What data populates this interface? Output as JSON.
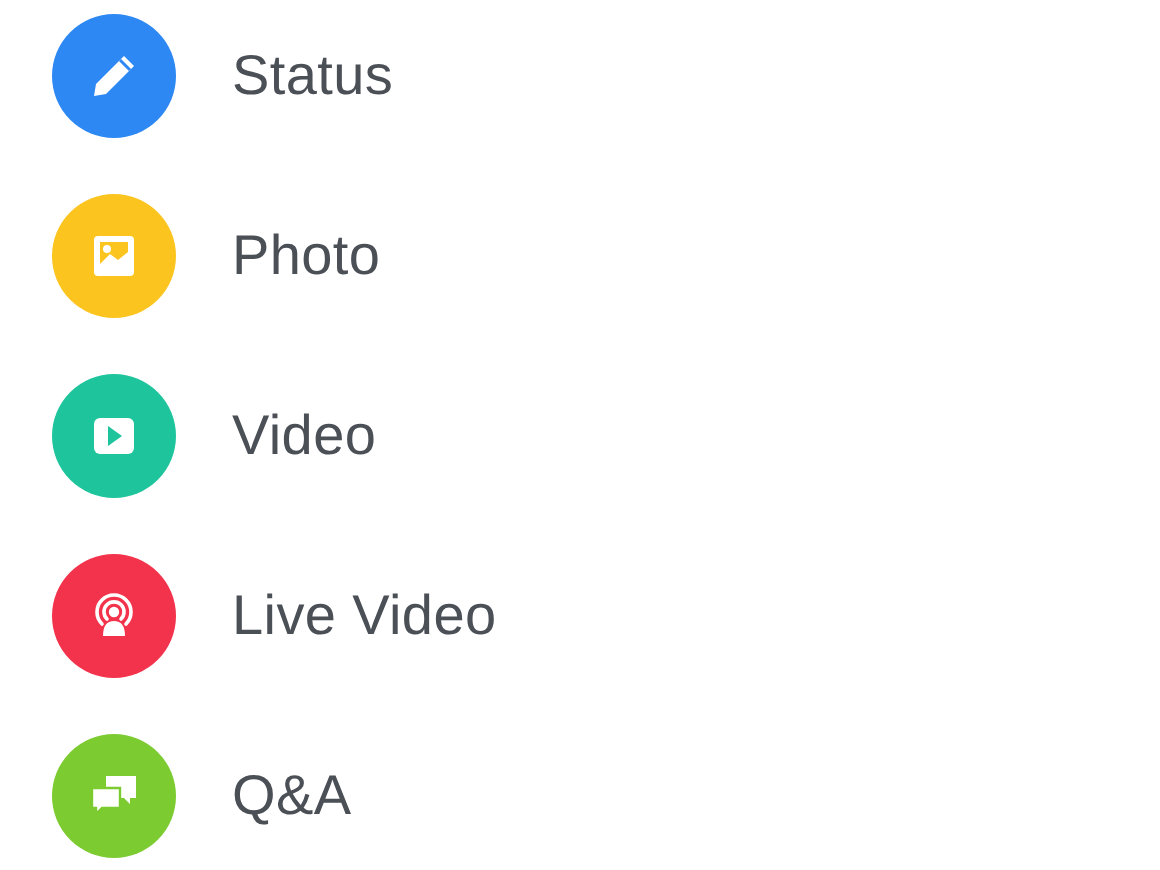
{
  "options": [
    {
      "label": "Status",
      "kind": "pencil",
      "color": "#2d88f3"
    },
    {
      "label": "Photo",
      "kind": "photo",
      "color": "#fbc41f"
    },
    {
      "label": "Video",
      "kind": "video",
      "color": "#1ec49c"
    },
    {
      "label": "Live Video",
      "kind": "live",
      "color": "#f3334b"
    },
    {
      "label": "Q&A",
      "kind": "chat",
      "color": "#7ccb30"
    }
  ]
}
